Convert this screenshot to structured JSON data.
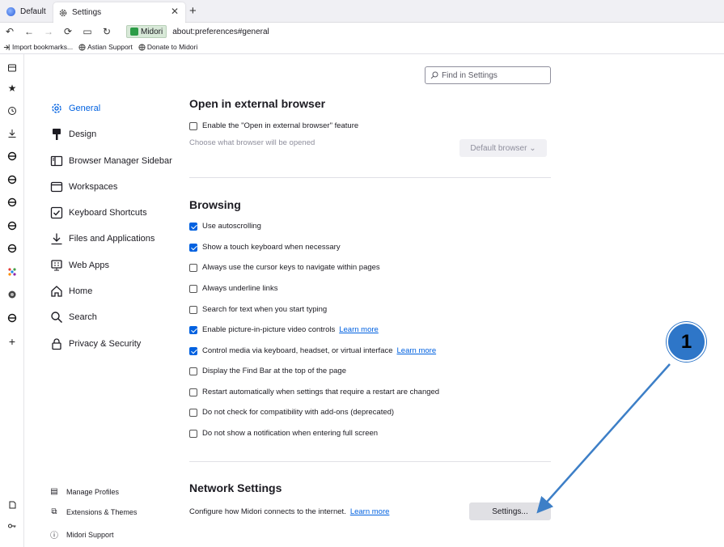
{
  "tabs": [
    {
      "label": "Default"
    },
    {
      "label": "Settings"
    }
  ],
  "nav": {
    "identity_label": "Midori",
    "url": "about:preferences#general"
  },
  "bookmarks": [
    {
      "label": "Import bookmarks..."
    },
    {
      "label": "Astian Support"
    },
    {
      "label": "Donate to Midori"
    }
  ],
  "categories": [
    {
      "label": "General",
      "icon": "gear-icon"
    },
    {
      "label": "Design",
      "icon": "paint-brush-icon"
    },
    {
      "label": "Browser Manager Sidebar",
      "icon": "sidebar-icon"
    },
    {
      "label": "Workspaces",
      "icon": "window-icon"
    },
    {
      "label": "Keyboard Shortcuts",
      "icon": "keyboard-check-icon"
    },
    {
      "label": "Files and Applications",
      "icon": "download-icon"
    },
    {
      "label": "Web Apps",
      "icon": "web-apps-icon"
    },
    {
      "label": "Home",
      "icon": "home-icon"
    },
    {
      "label": "Search",
      "icon": "search-icon"
    },
    {
      "label": "Privacy & Security",
      "icon": "lock-icon"
    }
  ],
  "footer": [
    {
      "label": "Manage Profiles"
    },
    {
      "label": "Extensions & Themes"
    },
    {
      "label": "Midori Support"
    }
  ],
  "search": {
    "placeholder": "Find in Settings"
  },
  "external": {
    "heading": "Open in external browser",
    "checkbox": "Enable the \"Open in external browser\" feature",
    "hint": "Choose what browser will be opened",
    "button": "Default browser ⌄"
  },
  "browsing": {
    "heading": "Browsing",
    "items": [
      {
        "label": "Use autoscrolling",
        "checked": true,
        "link": ""
      },
      {
        "label": "Show a touch keyboard when necessary",
        "checked": true,
        "link": ""
      },
      {
        "label": "Always use the cursor keys to navigate within pages",
        "checked": false,
        "link": ""
      },
      {
        "label": "Always underline links",
        "checked": false,
        "link": ""
      },
      {
        "label": "Search for text when you start typing",
        "checked": false,
        "link": ""
      },
      {
        "label": "Enable picture-in-picture video controls",
        "checked": true,
        "link": "Learn more"
      },
      {
        "label": "Control media via keyboard, headset, or virtual interface",
        "checked": true,
        "link": "Learn more"
      },
      {
        "label": "Display the Find Bar at the top of the page",
        "checked": false,
        "link": ""
      },
      {
        "label": "Restart automatically when settings that require a restart are changed",
        "checked": false,
        "link": ""
      },
      {
        "label": "Do not check for compatibility with add-ons (deprecated)",
        "checked": false,
        "link": ""
      },
      {
        "label": "Do not show a notification when entering full screen",
        "checked": false,
        "link": ""
      }
    ]
  },
  "network": {
    "heading": "Network Settings",
    "description": "Configure how Midori connects to the internet.",
    "link": "Learn more",
    "button": "Settings..."
  },
  "annotation": {
    "number": "1"
  },
  "colors": {
    "accent": "#0061e0",
    "annotation": "#2e76c8"
  }
}
